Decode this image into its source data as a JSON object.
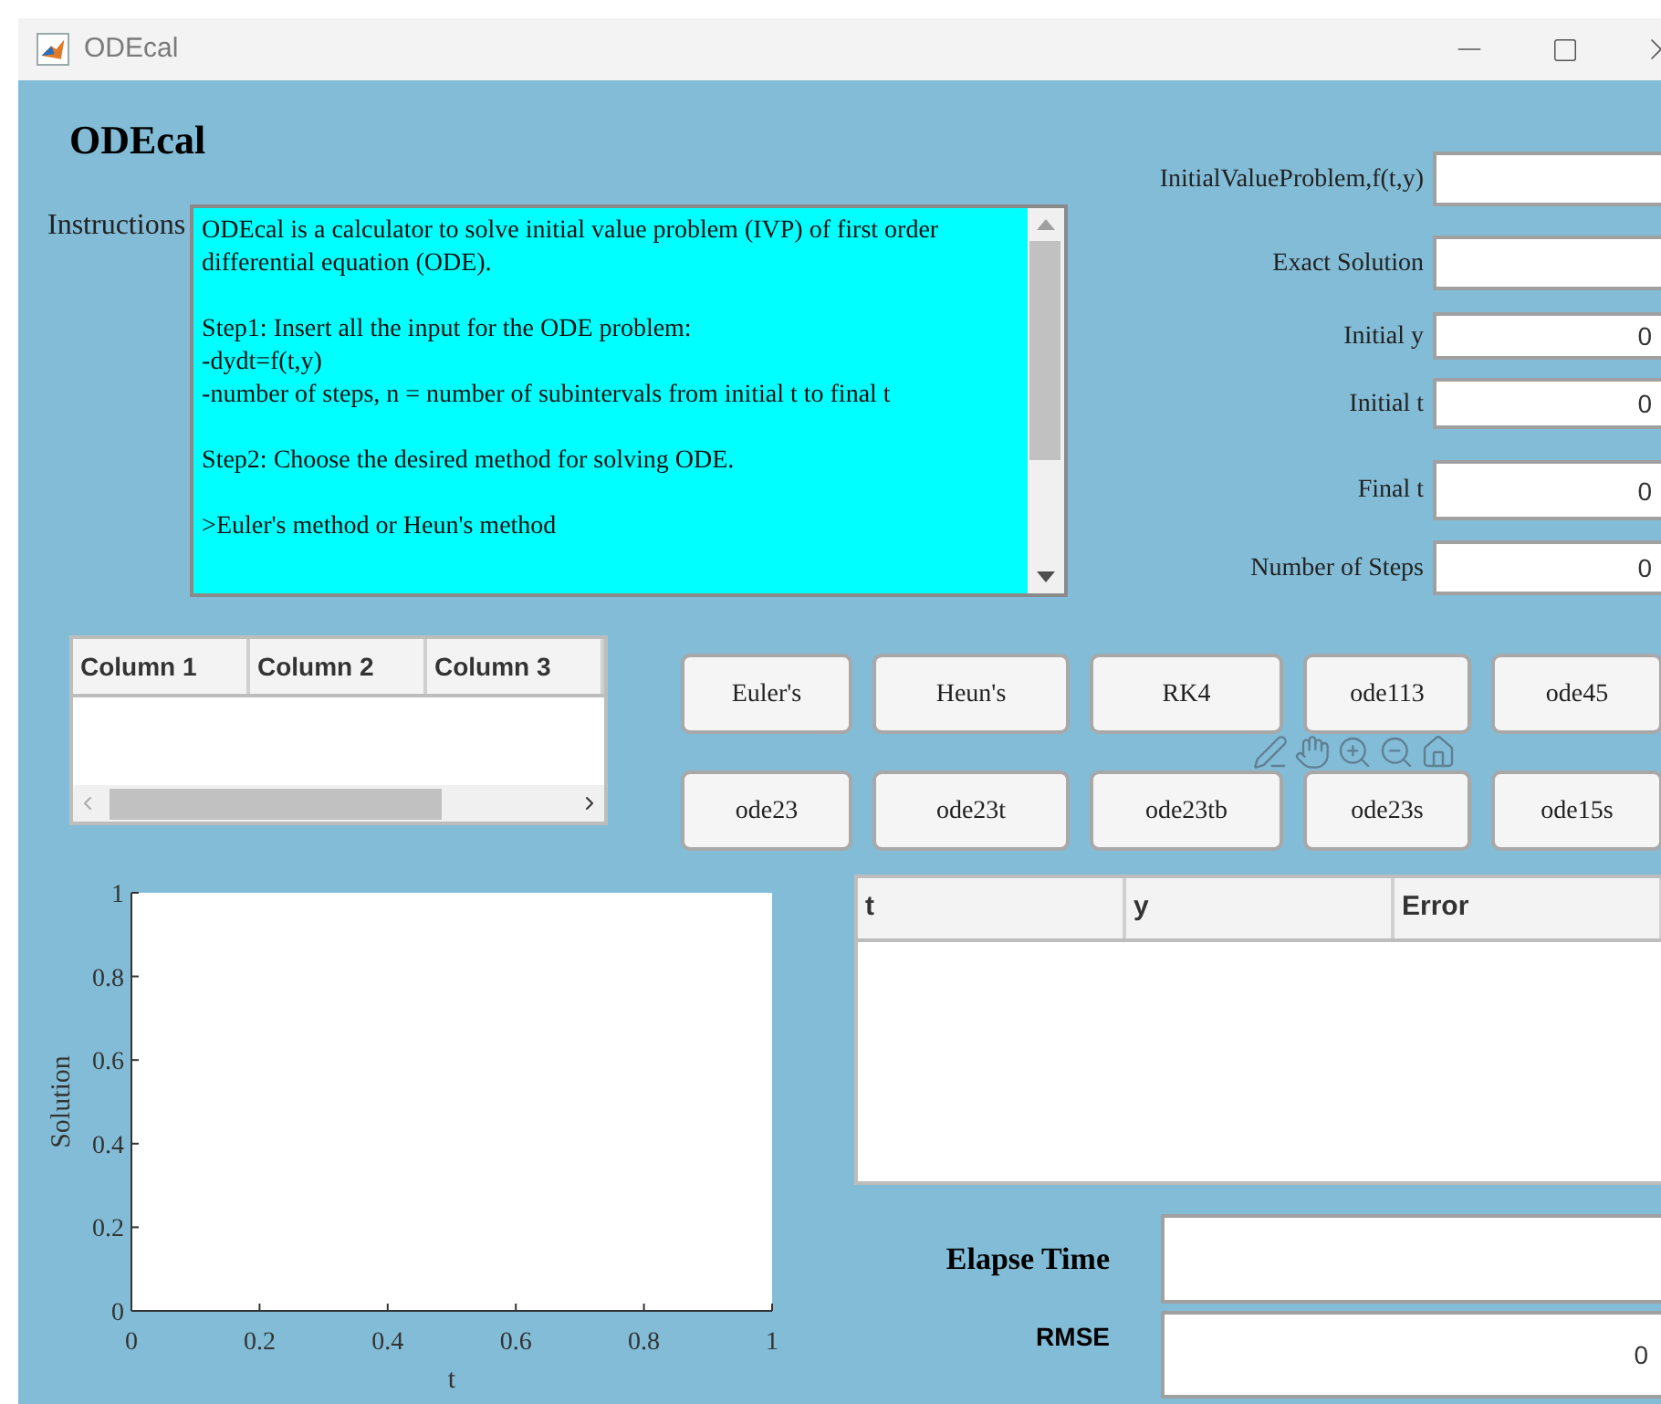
{
  "window": {
    "title": "ODEcal"
  },
  "app_title": "ODEcal",
  "instructions": {
    "label": "Instructions",
    "paragraphs": [
      "ODEcal is a calculator to solve initial value problem (IVP) of first order differential equation (ODE).",
      "Step1: Insert all the input for the ODE problem:\n-dydt=f(t,y)\n-number of steps, n = number of subintervals from initial t to final t",
      "Step2: Choose the desired method for solving ODE.",
      ">Euler's method or Heun's method"
    ]
  },
  "inputs": [
    {
      "label": "InitialValueProblem,f(t,y)"
    },
    {
      "label": "Exact Solution"
    },
    {
      "label": "Initial y",
      "value": "0"
    },
    {
      "label": "Initial t",
      "value": "0"
    },
    {
      "label": "Final t",
      "value": "0"
    },
    {
      "label": "Number of Steps",
      "value": "0"
    }
  ],
  "table": {
    "columns": [
      "Column 1",
      "Column 2",
      "Column 3"
    ]
  },
  "method_buttons": [
    [
      "Euler's",
      "Heun's",
      "RK4",
      "ode113",
      "ode45"
    ],
    [
      "ode23",
      "ode23t",
      "ode23tb",
      "ode23s",
      "ode15s"
    ]
  ],
  "plot": {
    "chart_data": {
      "type": "line",
      "xlabel": "t",
      "ylabel": "Solution",
      "xlim": [
        0,
        1
      ],
      "ylim": [
        0,
        1
      ],
      "xticks": [
        0,
        0.2,
        0.4,
        0.6,
        0.8,
        1
      ],
      "yticks": [
        0,
        0.2,
        0.4,
        0.6,
        0.8,
        1
      ]
    }
  },
  "results_table": {
    "columns": [
      "t",
      "y",
      "Error"
    ]
  },
  "outputs": [
    {
      "label": "Elapse Time"
    },
    {
      "label": "RMSE",
      "value": "0"
    }
  ]
}
